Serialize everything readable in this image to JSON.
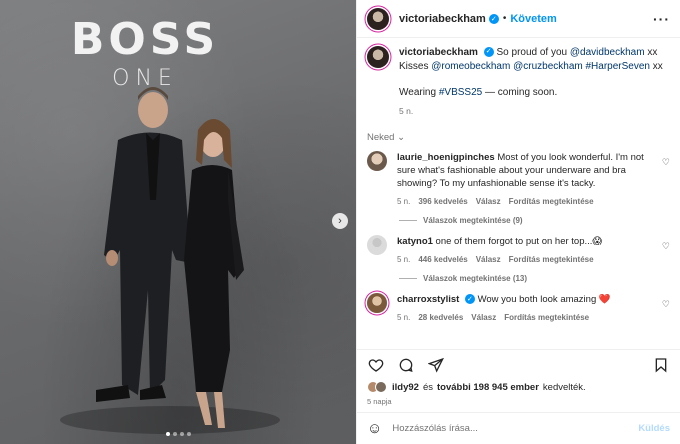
{
  "post": {
    "brand_title": "BOSS",
    "brand_subtitle": "ONE"
  },
  "header": {
    "username": "victoriabeckham",
    "separator": "•",
    "follow_label": "Követem",
    "more_label": "···"
  },
  "caption": {
    "username": "victoriabeckham",
    "text_1": "So proud of you",
    "mention_1": "@davidbeckham",
    "text_2": "xx Kisses",
    "mention_2": "@romeobeckham",
    "mention_3": "@cruzbeckham",
    "hashtag_1": "#HarperSeven",
    "text_3": "xx",
    "line2_a": "Wearing",
    "hashtag_2": "#VBSS25",
    "line2_b": "— coming soon.",
    "time": "5 n."
  },
  "translate_label": "Neked",
  "comments": [
    {
      "username": "laurie_hoenigpinches",
      "text": "Most of you look wonderful. I'm not sure what's fashionable about your underware and bra showing? To my unfashionable sense it's tacky.",
      "time": "5 n.",
      "likes": "396 kedvelés",
      "reply": "Válasz",
      "translate": "Fordítás megtekintése",
      "view_replies": "Válaszok megtekintése (9)"
    },
    {
      "username": "katyno1",
      "text": "one of them forgot to put on her top...😱",
      "time": "5 n.",
      "likes": "446 kedvelés",
      "reply": "Válasz",
      "translate": "Fordítás megtekintése",
      "view_replies": "Válaszok megtekintése (13)"
    },
    {
      "username": "charroxstylist",
      "text": "Wow you both look amazing ❤️",
      "time": "5 n.",
      "likes": "28 kedvelés",
      "reply": "Válasz",
      "translate": "Fordítás megtekintése"
    }
  ],
  "likes_line": {
    "user": "ildy92",
    "and": "és",
    "others": "további 198 945 ember",
    "suffix": "kedvelték."
  },
  "date": "5 napja",
  "composer": {
    "placeholder": "Hozzászólás írása...",
    "send_label": "Küldés"
  },
  "colors": {
    "accent": "#0095f6",
    "text": "#262626",
    "muted": "#737373",
    "heart": "#ed4956"
  }
}
